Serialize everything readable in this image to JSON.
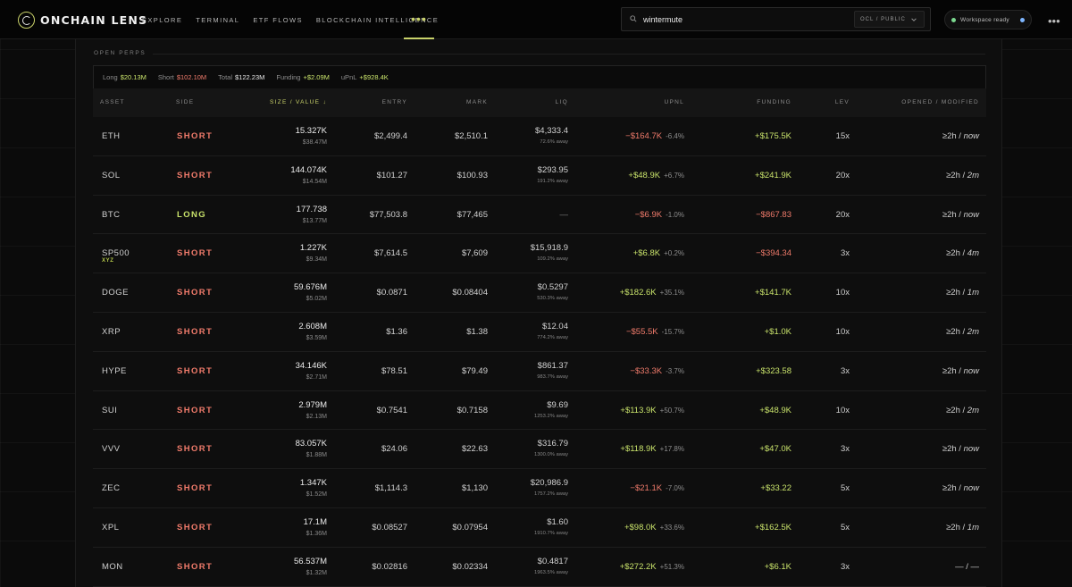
{
  "brand": {
    "name": "ONCHAIN LENS"
  },
  "nav": {
    "items": [
      "Explore",
      "Terminal",
      "ETF Flows",
      "Blockchain Intelligence"
    ],
    "more": "•••"
  },
  "search": {
    "value": "wintermute",
    "scope": "OCL / PUBLIC"
  },
  "workspace": {
    "status": "Workspace ready"
  },
  "section": {
    "title": "OPEN PERPS"
  },
  "summary": {
    "long_label": "Long",
    "long_value": "$20.13M",
    "short_label": "Short",
    "short_value": "$102.10M",
    "total_label": "Total",
    "total_value": "$122.23M",
    "funding_label": "Funding",
    "funding_value": "+$2.09M",
    "upnl_label": "uPnL",
    "upnl_value": "+$928.4K"
  },
  "columns": {
    "asset": "ASSET",
    "side": "SIDE",
    "size": "SIZE / VALUE",
    "entry": "ENTRY",
    "mark": "MARK",
    "liq": "LIQ",
    "upnl": "UPNL",
    "funding": "FUNDING",
    "lev": "LEV",
    "opened": "OPENED / MODIFIED"
  },
  "rows": [
    {
      "asset": "ETH",
      "sub": "",
      "side": "SHORT",
      "size": "15.327K",
      "value": "$38.47M",
      "entry": "$2,499.4",
      "mark": "$2,510.1",
      "liq": "$4,333.4",
      "liq_away": "72.6% away",
      "upnl": "−$164.7K",
      "upnl_pct": "-6.4%",
      "upnl_sign": "neg",
      "funding": "+$175.5K",
      "funding_sign": "pos",
      "lev": "15x",
      "opened": "≥2h",
      "modified": "now"
    },
    {
      "asset": "SOL",
      "sub": "",
      "side": "SHORT",
      "size": "144.074K",
      "value": "$14.54M",
      "entry": "$101.27",
      "mark": "$100.93",
      "liq": "$293.95",
      "liq_away": "191.2% away",
      "upnl": "+$48.9K",
      "upnl_pct": "+6.7%",
      "upnl_sign": "pos",
      "funding": "+$241.9K",
      "funding_sign": "pos",
      "lev": "20x",
      "opened": "≥2h",
      "modified": "2m"
    },
    {
      "asset": "BTC",
      "sub": "",
      "side": "LONG",
      "size": "177.738",
      "value": "$13.77M",
      "entry": "$77,503.8",
      "mark": "$77,465",
      "liq": "—",
      "liq_away": "",
      "upnl": "−$6.9K",
      "upnl_pct": "-1.0%",
      "upnl_sign": "neg",
      "funding": "−$867.83",
      "funding_sign": "neg",
      "lev": "20x",
      "opened": "≥2h",
      "modified": "now"
    },
    {
      "asset": "SP500",
      "sub": "XYZ",
      "side": "SHORT",
      "size": "1.227K",
      "value": "$9.34M",
      "entry": "$7,614.5",
      "mark": "$7,609",
      "liq": "$15,918.9",
      "liq_away": "109.2% away",
      "upnl": "+$6.8K",
      "upnl_pct": "+0.2%",
      "upnl_sign": "pos",
      "funding": "−$394.34",
      "funding_sign": "neg",
      "lev": "3x",
      "opened": "≥2h",
      "modified": "4m"
    },
    {
      "asset": "DOGE",
      "sub": "",
      "side": "SHORT",
      "size": "59.676M",
      "value": "$5.02M",
      "entry": "$0.0871",
      "mark": "$0.08404",
      "liq": "$0.5297",
      "liq_away": "530.3% away",
      "upnl": "+$182.6K",
      "upnl_pct": "+35.1%",
      "upnl_sign": "pos",
      "funding": "+$141.7K",
      "funding_sign": "pos",
      "lev": "10x",
      "opened": "≥2h",
      "modified": "1m"
    },
    {
      "asset": "XRP",
      "sub": "",
      "side": "SHORT",
      "size": "2.608M",
      "value": "$3.59M",
      "entry": "$1.36",
      "mark": "$1.38",
      "liq": "$12.04",
      "liq_away": "774.2% away",
      "upnl": "−$55.5K",
      "upnl_pct": "-15.7%",
      "upnl_sign": "neg",
      "funding": "+$1.0K",
      "funding_sign": "pos",
      "lev": "10x",
      "opened": "≥2h",
      "modified": "2m"
    },
    {
      "asset": "HYPE",
      "sub": "",
      "side": "SHORT",
      "size": "34.146K",
      "value": "$2.71M",
      "entry": "$78.51",
      "mark": "$79.49",
      "liq": "$861.37",
      "liq_away": "983.7% away",
      "upnl": "−$33.3K",
      "upnl_pct": "-3.7%",
      "upnl_sign": "neg",
      "funding": "+$323.58",
      "funding_sign": "pos",
      "lev": "3x",
      "opened": "≥2h",
      "modified": "now"
    },
    {
      "asset": "SUI",
      "sub": "",
      "side": "SHORT",
      "size": "2.979M",
      "value": "$2.13M",
      "entry": "$0.7541",
      "mark": "$0.7158",
      "liq": "$9.69",
      "liq_away": "1253.2% away",
      "upnl": "+$113.9K",
      "upnl_pct": "+50.7%",
      "upnl_sign": "pos",
      "funding": "+$48.9K",
      "funding_sign": "pos",
      "lev": "10x",
      "opened": "≥2h",
      "modified": "2m"
    },
    {
      "asset": "VVV",
      "sub": "",
      "side": "SHORT",
      "size": "83.057K",
      "value": "$1.88M",
      "entry": "$24.06",
      "mark": "$22.63",
      "liq": "$316.79",
      "liq_away": "1300.0% away",
      "upnl": "+$118.9K",
      "upnl_pct": "+17.8%",
      "upnl_sign": "pos",
      "funding": "+$47.0K",
      "funding_sign": "pos",
      "lev": "3x",
      "opened": "≥2h",
      "modified": "now"
    },
    {
      "asset": "ZEC",
      "sub": "",
      "side": "SHORT",
      "size": "1.347K",
      "value": "$1.52M",
      "entry": "$1,114.3",
      "mark": "$1,130",
      "liq": "$20,986.9",
      "liq_away": "1757.2% away",
      "upnl": "−$21.1K",
      "upnl_pct": "-7.0%",
      "upnl_sign": "neg",
      "funding": "+$33.22",
      "funding_sign": "pos",
      "lev": "5x",
      "opened": "≥2h",
      "modified": "now"
    },
    {
      "asset": "XPL",
      "sub": "",
      "side": "SHORT",
      "size": "17.1M",
      "value": "$1.36M",
      "entry": "$0.08527",
      "mark": "$0.07954",
      "liq": "$1.60",
      "liq_away": "1910.7% away",
      "upnl": "+$98.0K",
      "upnl_pct": "+33.6%",
      "upnl_sign": "pos",
      "funding": "+$162.5K",
      "funding_sign": "pos",
      "lev": "5x",
      "opened": "≥2h",
      "modified": "1m"
    },
    {
      "asset": "MON",
      "sub": "",
      "side": "SHORT",
      "size": "56.537M",
      "value": "$1.32M",
      "entry": "$0.02816",
      "mark": "$0.02334",
      "liq": "$0.4817",
      "liq_away": "1963.5% away",
      "upnl": "+$272.2K",
      "upnl_pct": "+51.3%",
      "upnl_sign": "pos",
      "funding": "+$6.1K",
      "funding_sign": "pos",
      "lev": "3x",
      "opened": "—",
      "modified": "—"
    }
  ],
  "colors": {
    "accent": "#c9d26a",
    "positive": "#c9e36b",
    "negative": "#f07b6b",
    "background": "#0b0b0b"
  }
}
